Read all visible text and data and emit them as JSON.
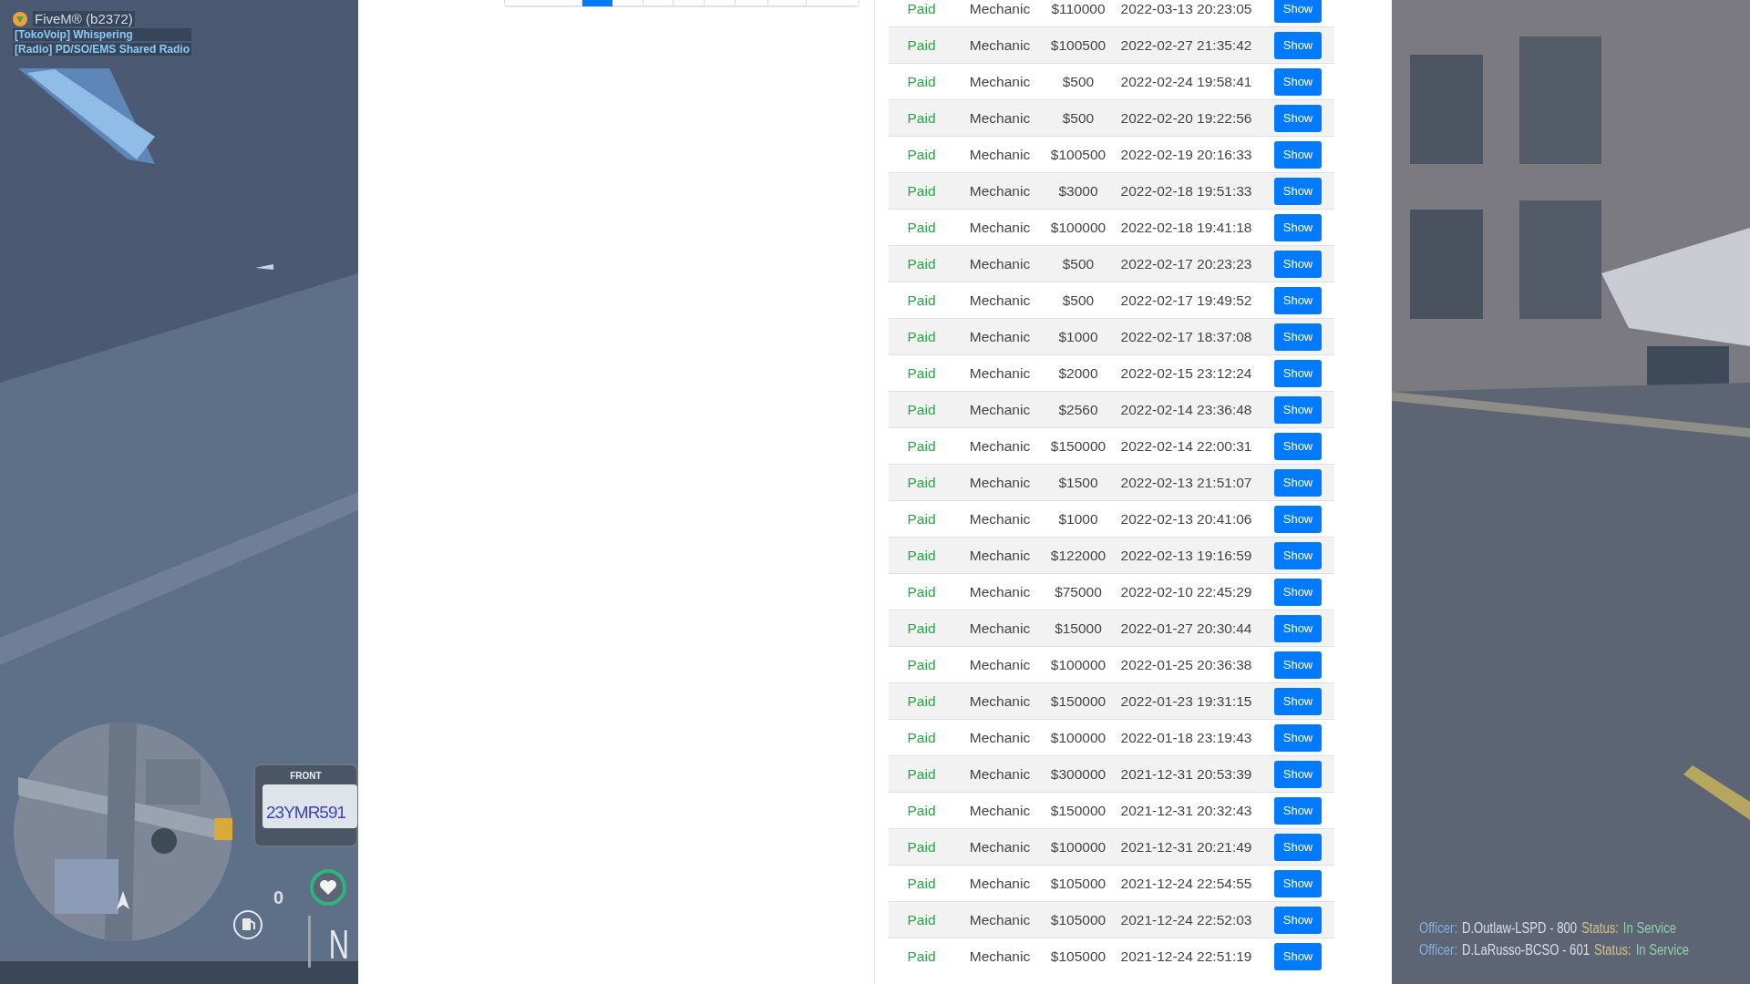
{
  "hud": {
    "title": "FiveM® (b2372)",
    "voice_lines": [
      "[TokoVoip] Whispering",
      "[Radio] PD/SO/EMS Shared Radio"
    ],
    "plate": {
      "label": "FRONT",
      "number": "23YMR591"
    },
    "speed": "0",
    "gear": "N"
  },
  "pagination": [
    {
      "selected": false
    },
    {
      "selected": true
    },
    {
      "selected": false
    },
    {
      "selected": false
    },
    {
      "selected": false
    },
    {
      "selected": false
    },
    {
      "selected": false
    },
    {
      "selected": false
    },
    {
      "selected": false
    }
  ],
  "table": {
    "rows": [
      {
        "status": "Paid",
        "type": "Mechanic",
        "amount": "$110000",
        "date": "2022-03-13 20:23:05",
        "action": "Show"
      },
      {
        "status": "Paid",
        "type": "Mechanic",
        "amount": "$100500",
        "date": "2022-02-27 21:35:42",
        "action": "Show"
      },
      {
        "status": "Paid",
        "type": "Mechanic",
        "amount": "$500",
        "date": "2022-02-24 19:58:41",
        "action": "Show"
      },
      {
        "status": "Paid",
        "type": "Mechanic",
        "amount": "$500",
        "date": "2022-02-20 19:22:56",
        "action": "Show"
      },
      {
        "status": "Paid",
        "type": "Mechanic",
        "amount": "$100500",
        "date": "2022-02-19 20:16:33",
        "action": "Show"
      },
      {
        "status": "Paid",
        "type": "Mechanic",
        "amount": "$3000",
        "date": "2022-02-18 19:51:33",
        "action": "Show"
      },
      {
        "status": "Paid",
        "type": "Mechanic",
        "amount": "$100000",
        "date": "2022-02-18 19:41:18",
        "action": "Show"
      },
      {
        "status": "Paid",
        "type": "Mechanic",
        "amount": "$500",
        "date": "2022-02-17 20:23:23",
        "action": "Show"
      },
      {
        "status": "Paid",
        "type": "Mechanic",
        "amount": "$500",
        "date": "2022-02-17 19:49:52",
        "action": "Show"
      },
      {
        "status": "Paid",
        "type": "Mechanic",
        "amount": "$1000",
        "date": "2022-02-17 18:37:08",
        "action": "Show"
      },
      {
        "status": "Paid",
        "type": "Mechanic",
        "amount": "$2000",
        "date": "2022-02-15 23:12:24",
        "action": "Show"
      },
      {
        "status": "Paid",
        "type": "Mechanic",
        "amount": "$2560",
        "date": "2022-02-14 23:36:48",
        "action": "Show"
      },
      {
        "status": "Paid",
        "type": "Mechanic",
        "amount": "$150000",
        "date": "2022-02-14 22:00:31",
        "action": "Show"
      },
      {
        "status": "Paid",
        "type": "Mechanic",
        "amount": "$1500",
        "date": "2022-02-13 21:51:07",
        "action": "Show"
      },
      {
        "status": "Paid",
        "type": "Mechanic",
        "amount": "$1000",
        "date": "2022-02-13 20:41:06",
        "action": "Show"
      },
      {
        "status": "Paid",
        "type": "Mechanic",
        "amount": "$122000",
        "date": "2022-02-13 19:16:59",
        "action": "Show"
      },
      {
        "status": "Paid",
        "type": "Mechanic",
        "amount": "$75000",
        "date": "2022-02-10 22:45:29",
        "action": "Show"
      },
      {
        "status": "Paid",
        "type": "Mechanic",
        "amount": "$15000",
        "date": "2022-01-27 20:30:44",
        "action": "Show"
      },
      {
        "status": "Paid",
        "type": "Mechanic",
        "amount": "$100000",
        "date": "2022-01-25 20:36:38",
        "action": "Show"
      },
      {
        "status": "Paid",
        "type": "Mechanic",
        "amount": "$150000",
        "date": "2022-01-23 19:31:15",
        "action": "Show"
      },
      {
        "status": "Paid",
        "type": "Mechanic",
        "amount": "$100000",
        "date": "2022-01-18 23:19:43",
        "action": "Show"
      },
      {
        "status": "Paid",
        "type": "Mechanic",
        "amount": "$300000",
        "date": "2021-12-31 20:53:39",
        "action": "Show"
      },
      {
        "status": "Paid",
        "type": "Mechanic",
        "amount": "$150000",
        "date": "2021-12-31 20:32:43",
        "action": "Show"
      },
      {
        "status": "Paid",
        "type": "Mechanic",
        "amount": "$100000",
        "date": "2021-12-31 20:21:49",
        "action": "Show"
      },
      {
        "status": "Paid",
        "type": "Mechanic",
        "amount": "$105000",
        "date": "2021-12-24 22:54:55",
        "action": "Show"
      },
      {
        "status": "Paid",
        "type": "Mechanic",
        "amount": "$105000",
        "date": "2021-12-24 22:52:03",
        "action": "Show"
      },
      {
        "status": "Paid",
        "type": "Mechanic",
        "amount": "$105000",
        "date": "2021-12-24 22:51:19",
        "action": "Show"
      }
    ]
  },
  "officers": [
    {
      "label": "Officer:",
      "name": "D.Outlaw-LSPD - 800",
      "status_label": "Status:",
      "status": "In Service"
    },
    {
      "label": "Officer:",
      "name": "D.LaRusso-BCSO - 601",
      "status_label": "Status:",
      "status": "In Service"
    }
  ]
}
